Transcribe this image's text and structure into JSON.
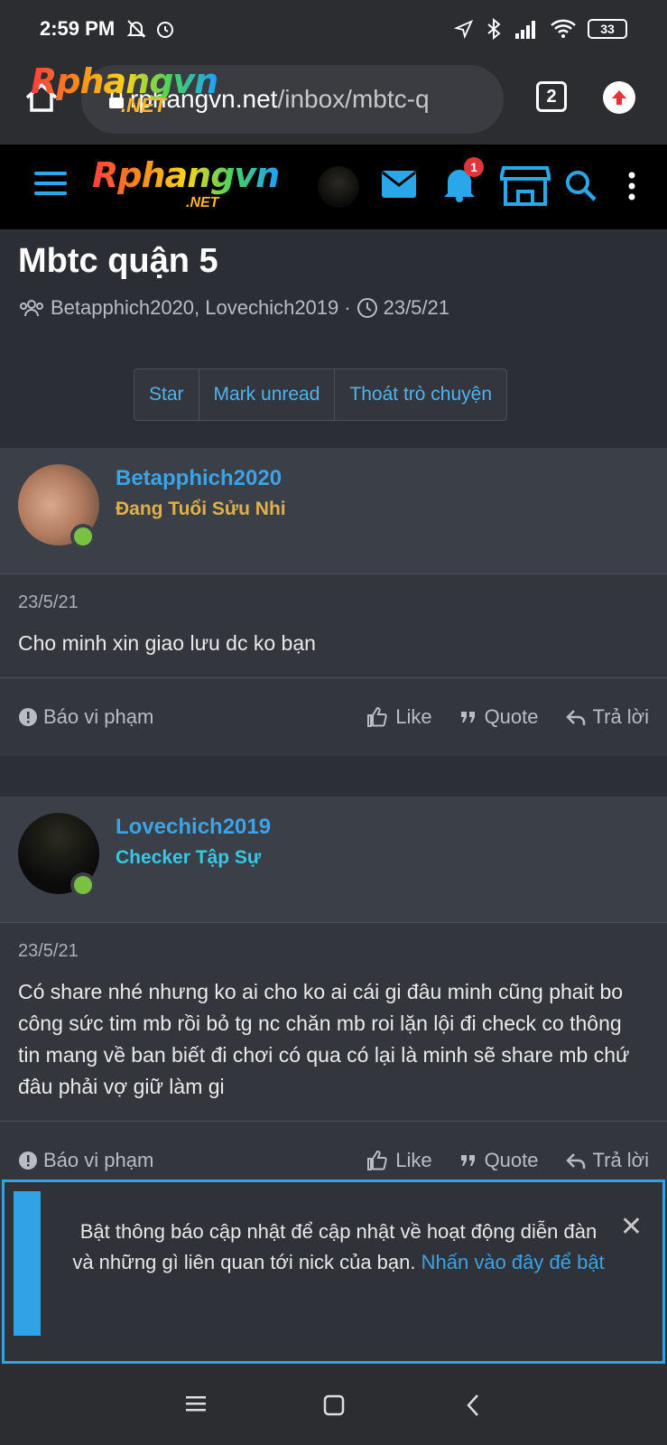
{
  "status_bar": {
    "time": "2:59 PM",
    "battery": "33"
  },
  "browser": {
    "url_host": "rphangvn.net",
    "url_path": "/inbox/mbtc-q",
    "logo_text": "Rphangvn",
    "logo_sub": ".NET",
    "tab_count": "2"
  },
  "site": {
    "logo_text": "Rphangvn",
    "logo_sub": ".NET",
    "notification_count": "1"
  },
  "conversation": {
    "title": "Mbtc quận 5",
    "participants": "Betapphich2020, Lovechich2019",
    "separator": "·",
    "date": "23/5/21",
    "actions": [
      "Star",
      "Mark unread",
      "Thoát trò chuyện"
    ]
  },
  "messages": [
    {
      "username": "Betapphich2020",
      "user_title": "Đang Tuổi Sửu Nhi",
      "title_color": "#e0b04a",
      "date": "23/5/21",
      "text": "Cho minh xin giao lưu dc ko bạn",
      "report": "Báo vi phạm",
      "like": "Like",
      "quote": "Quote",
      "reply": "Trả lời"
    },
    {
      "username": "Lovechich2019",
      "user_title": "Checker Tập Sự",
      "title_color": "#37c8e6",
      "date": "23/5/21",
      "text": "Có share nhé nhưng ko ai cho ko ai cái gi đâu minh cũng phait bo công sức tim mb rồi bỏ tg nc chăn mb roi lặn lội đi check co thông tin mang về ban biết đi chơi có qua có lại là minh sẽ share mb chứ đâu phải vợ giữ làm gi",
      "report": "Báo vi phạm",
      "like": "Like",
      "quote": "Quote",
      "reply": "Trả lời"
    }
  ],
  "notice": {
    "text": "Bật thông báo cập nhật để cập nhật về hoạt động diễn đàn và những gì liên quan tới nick của bạn.",
    "link": "Nhấn vào đây để bật",
    "close": "✕"
  },
  "colors": {
    "accent": "#3ba3e6",
    "online": "#7ac142",
    "badge": "#e0353a"
  }
}
